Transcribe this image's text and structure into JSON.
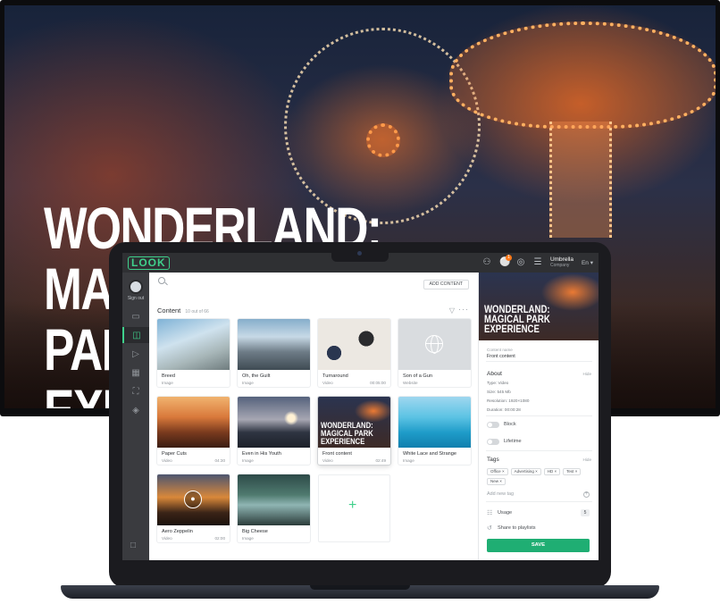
{
  "tv": {
    "headline": "WONDERLAND:\nMAGICAL PARK\nEXPERIENCE"
  },
  "app": {
    "logo": "LOOK",
    "topbar": {
      "notification_count": "1",
      "account_name": "Umbrella",
      "account_sub": "Company",
      "language": "En"
    },
    "rail": {
      "sign_out": "Sign out"
    },
    "content": {
      "add_button": "ADD CONTENT",
      "title": "Content",
      "count": "10 out of 66",
      "cards": [
        {
          "name": "Breed",
          "type": "Image",
          "time": ""
        },
        {
          "name": "Oh, the Guilt",
          "type": "Image",
          "time": ""
        },
        {
          "name": "Turnaround",
          "type": "Video",
          "time": "00:05:00"
        },
        {
          "name": "Son of a Gun",
          "type": "Website",
          "time": ""
        },
        {
          "name": "Paper Cuts",
          "type": "Video",
          "time": "04:30"
        },
        {
          "name": "Even in His Youth",
          "type": "Image",
          "time": ""
        },
        {
          "name": "Front content",
          "type": "Video",
          "time": "02:49"
        },
        {
          "name": "White Lace and Strange",
          "type": "Image",
          "time": ""
        },
        {
          "name": "Aero Zeppelin",
          "type": "Video",
          "time": "02:00"
        },
        {
          "name": "Big Cheese",
          "type": "Image",
          "time": ""
        }
      ],
      "thumb_text": "WONDERLAND:\nMAGICAL PARK\nEXPERIENCE"
    },
    "panel": {
      "hero_text": "WONDERLAND:\nMAGICAL PARK\nEXPERIENCE",
      "name_label": "Content name",
      "name_value": "Front content",
      "about_heading": "About",
      "hide_label": "Hide",
      "type_line": "Type: Video",
      "size_line": "Size: 545 Mb",
      "resolution_line": "Resolution: 1920×1080",
      "duration_line": "Duration: 00:00:28",
      "block_label": "Block",
      "lifetime_label": "Lifetime",
      "tags_heading": "Tags",
      "tags": [
        "Office",
        "Advertising",
        "HD",
        "Test",
        "New"
      ],
      "add_tag_placeholder": "Add new tag",
      "usage_label": "Usage",
      "usage_count": "5",
      "share_label": "Share to playlists",
      "save_label": "SAVE"
    }
  },
  "colors": {
    "brand": "#3fd08b",
    "save": "#1fae73",
    "badge": "#ff7a1a",
    "topbar": "#2f3033",
    "rail": "#3a3b3f"
  }
}
